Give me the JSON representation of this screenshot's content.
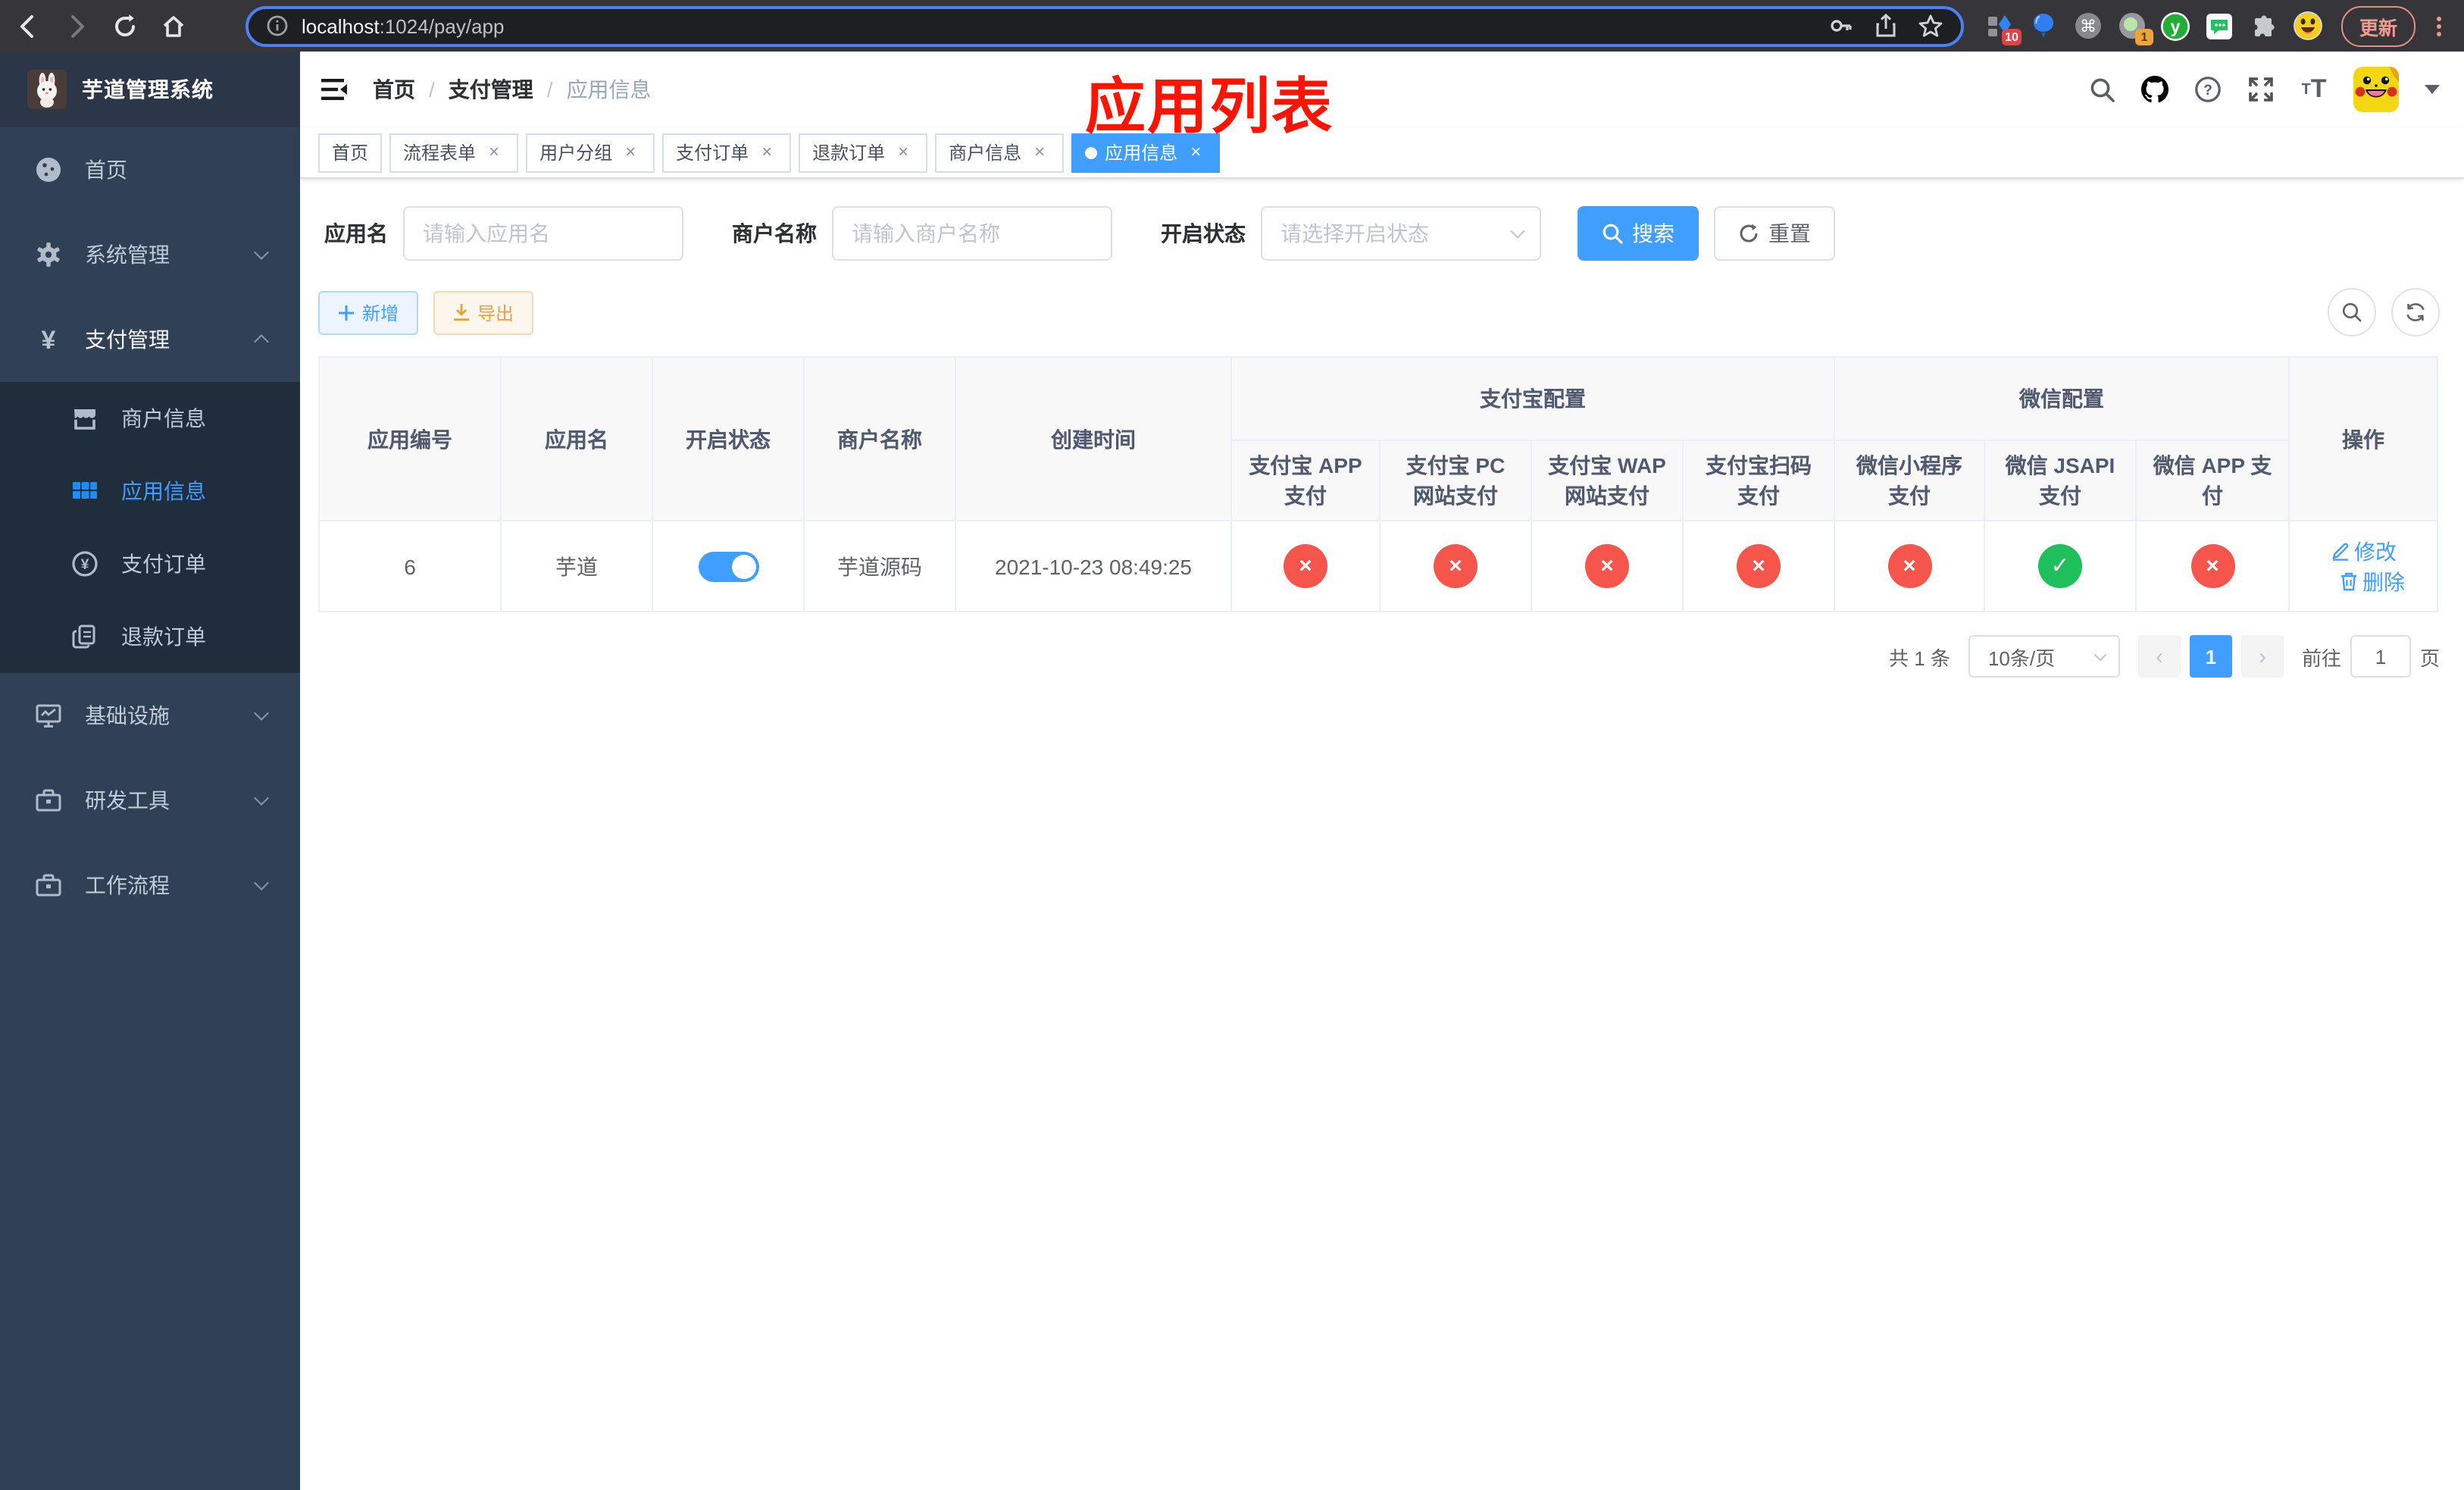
{
  "browser": {
    "url": {
      "host": "localhost",
      "path": ":1024/pay/app"
    },
    "update_label": "更新",
    "extensions": {
      "badge_a": "10",
      "badge_b": "1",
      "letter_y": "y"
    }
  },
  "ui": {
    "breadcrumb_separator": "/",
    "close_glyph": "×",
    "prev_glyph": "‹",
    "next_glyph": "›"
  },
  "sidebar": {
    "title": "芋道管理系统",
    "items": [
      {
        "label": "首页",
        "icon": "dashboard-icon"
      },
      {
        "label": "系统管理",
        "icon": "gear-icon"
      },
      {
        "label": "支付管理",
        "icon": "yen-icon"
      },
      {
        "label": "商户信息",
        "icon": "shop-icon"
      },
      {
        "label": "应用信息",
        "icon": "grid-icon"
      },
      {
        "label": "支付订单",
        "icon": "pay-order-icon"
      },
      {
        "label": "退款订单",
        "icon": "refund-icon"
      },
      {
        "label": "基础设施",
        "icon": "monitor-icon"
      },
      {
        "label": "研发工具",
        "icon": "toolbox-icon"
      },
      {
        "label": "工作流程",
        "icon": "workflow-icon"
      }
    ]
  },
  "header": {
    "breadcrumb": [
      {
        "label": "首页"
      },
      {
        "label": "支付管理"
      },
      {
        "label": "应用信息"
      }
    ],
    "annotation": "应用列表"
  },
  "tabs": {
    "items": [
      {
        "label": "首页"
      },
      {
        "label": "流程表单"
      },
      {
        "label": "用户分组"
      },
      {
        "label": "支付订单"
      },
      {
        "label": "退款订单"
      },
      {
        "label": "商户信息"
      },
      {
        "label": "应用信息"
      }
    ]
  },
  "filters": {
    "app_name": {
      "label": "应用名",
      "placeholder": "请输入应用名"
    },
    "merchant_name": {
      "label": "商户名称",
      "placeholder": "请输入商户名称"
    },
    "status": {
      "label": "开启状态",
      "placeholder": "请选择开启状态"
    },
    "search_label": "搜索",
    "reset_label": "重置"
  },
  "actions": {
    "add_label": "新增",
    "export_label": "导出"
  },
  "table": {
    "columns": {
      "app_id": "应用编号",
      "app_name": "应用名",
      "status": "开启状态",
      "merchant": "商户名称",
      "created": "创建时间",
      "alipay_group": "支付宝配置",
      "wechat_group": "微信配置",
      "actions": "操作"
    },
    "sub_columns": [
      {
        "label": "支付宝 APP 支付"
      },
      {
        "label": "支付宝 PC 网站支付"
      },
      {
        "label": "支付宝 WAP 网站支付"
      },
      {
        "label": "支付宝扫码支付"
      },
      {
        "label": "微信小程序支付"
      },
      {
        "label": "微信 JSAPI 支付"
      },
      {
        "label": "微信 APP 支付"
      }
    ],
    "row": {
      "app_id": "6",
      "app_name": "芋道",
      "status_on": true,
      "merchant": "芋道源码",
      "created": "2021-10-23 08:49:25",
      "configs": [
        {
          "state": "off",
          "mark": "×"
        },
        {
          "state": "off",
          "mark": "×"
        },
        {
          "state": "off",
          "mark": "×"
        },
        {
          "state": "off",
          "mark": "×"
        },
        {
          "state": "off",
          "mark": "×"
        },
        {
          "state": "on",
          "mark": "✓"
        },
        {
          "state": "off",
          "mark": "×"
        }
      ],
      "edit_label": "修改",
      "delete_label": "删除"
    }
  },
  "pagination": {
    "total": "共 1 条",
    "page_size": "10条/页",
    "current_page": "1",
    "goto_label": "前往",
    "goto_value": "1",
    "unit_label": "页"
  },
  "colors": {
    "accent": "#409eff",
    "success": "#1fc05c",
    "danger": "#f5554b",
    "warning": "#e6a23c",
    "annotation_red": "#fd1400",
    "sidebar_bg": "#304156",
    "submenu_bg": "#1f2d3d"
  }
}
